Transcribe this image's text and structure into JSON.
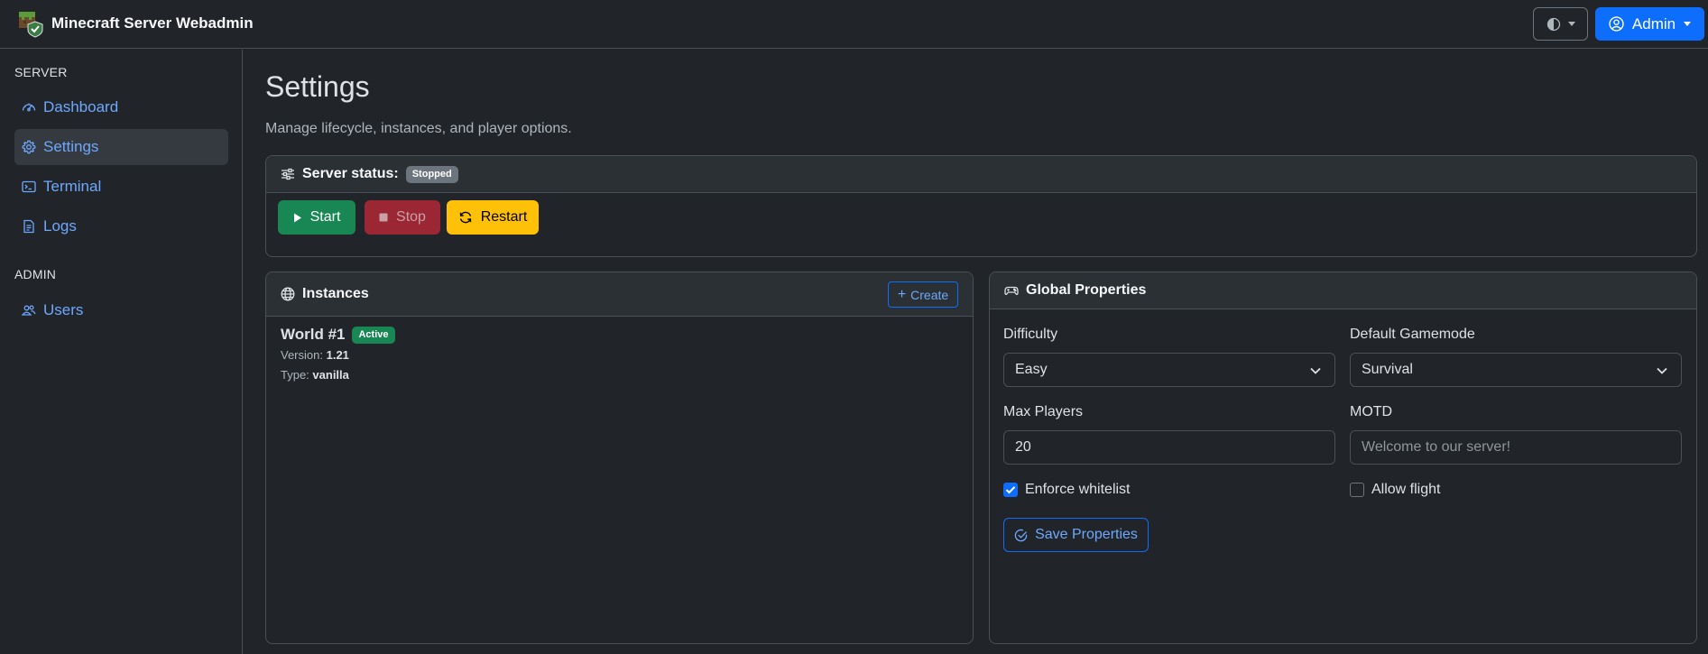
{
  "app": {
    "title": "Minecraft Server Webadmin",
    "user_label": "Admin",
    "theme_icon": "half-circle-icon"
  },
  "colors": {
    "primary": "#0d6efd",
    "success": "#198754",
    "danger": "#9b2634",
    "warning": "#ffc107",
    "secondary": "#6c757d",
    "background": "#212529"
  },
  "sidebar": {
    "sections": [
      {
        "heading": "SERVER",
        "items": [
          {
            "label": "Dashboard",
            "icon": "speedometer-icon",
            "active": false
          },
          {
            "label": "Settings",
            "icon": "gear-icon",
            "active": true
          },
          {
            "label": "Terminal",
            "icon": "terminal-icon",
            "active": false
          },
          {
            "label": "Logs",
            "icon": "file-text-icon",
            "active": false
          }
        ]
      },
      {
        "heading": "ADMIN",
        "items": [
          {
            "label": "Users",
            "icon": "users-icon",
            "active": false
          }
        ]
      }
    ]
  },
  "page": {
    "title": "Settings",
    "subtitle": "Manage lifecycle, instances, and player options."
  },
  "server_status": {
    "label": "Server status:",
    "status": "Stopped",
    "buttons": {
      "start": "Start",
      "stop": "Stop",
      "restart": "Restart"
    }
  },
  "instances": {
    "title": "Instances",
    "create_label": "Create",
    "items": [
      {
        "name": "World #1",
        "badge": "Active",
        "version_label": "Version:",
        "version": "1.21",
        "type_label": "Type:",
        "type": "vanilla"
      }
    ]
  },
  "global_properties": {
    "title": "Global Properties",
    "difficulty": {
      "label": "Difficulty",
      "value": "Easy"
    },
    "gamemode": {
      "label": "Default Gamemode",
      "value": "Survival"
    },
    "max_players": {
      "label": "Max Players",
      "value": "20"
    },
    "motd": {
      "label": "MOTD",
      "placeholder": "Welcome to our server!"
    },
    "enforce_whitelist": {
      "label": "Enforce whitelist",
      "checked": true
    },
    "allow_flight": {
      "label": "Allow flight",
      "checked": false
    },
    "save_label": "Save Properties"
  }
}
